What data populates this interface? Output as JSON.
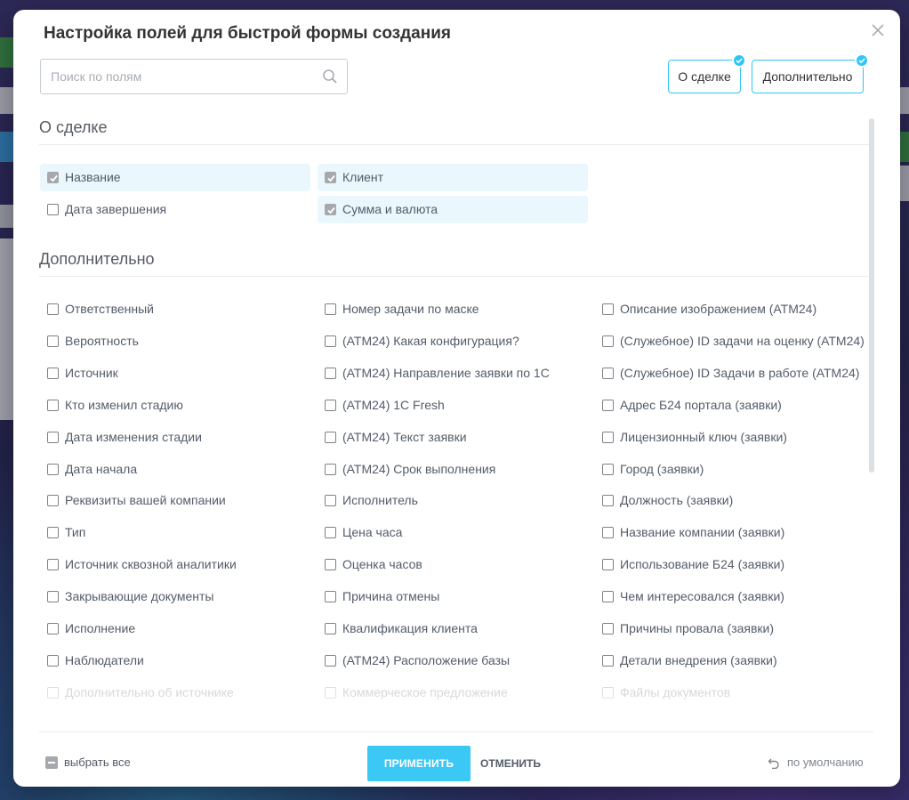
{
  "popup": {
    "title": "Настройка полей для быстрой формы создания",
    "search_placeholder": "Поиск по полям",
    "section_buttons": [
      {
        "label": "О сделке",
        "checked": true
      },
      {
        "label": "Дополнительно",
        "checked": true
      }
    ]
  },
  "sections": [
    {
      "title": "О сделке",
      "fields": [
        {
          "label": "Название",
          "checked": true
        },
        {
          "label": "Клиент",
          "checked": true
        },
        {
          "label": "Дата завершения",
          "checked": false
        },
        {
          "label": "Сумма и валюта",
          "checked": true
        }
      ]
    },
    {
      "title": "Дополнительно",
      "fields": [
        {
          "label": "Ответственный",
          "checked": false
        },
        {
          "label": "Номер задачи по маске",
          "checked": false
        },
        {
          "label": "Описание изображением (АТМ24)",
          "checked": false
        },
        {
          "label": "Вероятность",
          "checked": false
        },
        {
          "label": "(АТМ24) Какая конфигурация?",
          "checked": false
        },
        {
          "label": "(Служебное) ID задачи на оценку (АТМ24)",
          "checked": false
        },
        {
          "label": "Источник",
          "checked": false
        },
        {
          "label": "(АТМ24) Направление заявки по 1С",
          "checked": false
        },
        {
          "label": "(Служебное) ID Задачи в работе (АТМ24)",
          "checked": false
        },
        {
          "label": "Кто изменил стадию",
          "checked": false
        },
        {
          "label": "(АТМ24) 1С Fresh",
          "checked": false
        },
        {
          "label": "Адрес Б24 портала (заявки)",
          "checked": false
        },
        {
          "label": "Дата изменения стадии",
          "checked": false
        },
        {
          "label": "(АТМ24) Текст заявки",
          "checked": false
        },
        {
          "label": "Лицензионный ключ (заявки)",
          "checked": false
        },
        {
          "label": "Дата начала",
          "checked": false
        },
        {
          "label": "(АТМ24) Срок выполнения",
          "checked": false
        },
        {
          "label": "Город (заявки)",
          "checked": false
        },
        {
          "label": "Реквизиты вашей компании",
          "checked": false
        },
        {
          "label": "Исполнитель",
          "checked": false
        },
        {
          "label": "Должность (заявки)",
          "checked": false
        },
        {
          "label": "Тип",
          "checked": false
        },
        {
          "label": "Цена часа",
          "checked": false
        },
        {
          "label": "Название компании (заявки)",
          "checked": false
        },
        {
          "label": "Источник сквозной аналитики",
          "checked": false
        },
        {
          "label": "Оценка часов",
          "checked": false
        },
        {
          "label": "Использование Б24 (заявки)",
          "checked": false
        },
        {
          "label": "Закрывающие документы",
          "checked": false
        },
        {
          "label": "Причина отмены",
          "checked": false
        },
        {
          "label": "Чем интересовался (заявки)",
          "checked": false
        },
        {
          "label": "Исполнение",
          "checked": false
        },
        {
          "label": "Квалификация клиента",
          "checked": false
        },
        {
          "label": "Причины провала (заявки)",
          "checked": false
        },
        {
          "label": "Наблюдатели",
          "checked": false
        },
        {
          "label": "(АТМ24) Расположение базы",
          "checked": false
        },
        {
          "label": "Детали внедрения (заявки)",
          "checked": false
        },
        {
          "label": "Дополнительно об источнике",
          "checked": false
        },
        {
          "label": "Коммерческое предложение",
          "checked": false
        },
        {
          "label": "Файлы документов",
          "checked": false
        }
      ]
    }
  ],
  "footer": {
    "select_all": "выбрать все",
    "apply": "ПРИМЕНИТЬ",
    "cancel": "ОТМЕНИТЬ",
    "reset": "по умолчанию"
  },
  "colors": {
    "accent": "#2fc6f6",
    "apply_button": "#3bc8f5",
    "checked_row": "#eaf7fc"
  },
  "icons": {
    "search": "search-icon",
    "close": "close-icon",
    "reset": "undo-icon",
    "check": "check-icon"
  }
}
